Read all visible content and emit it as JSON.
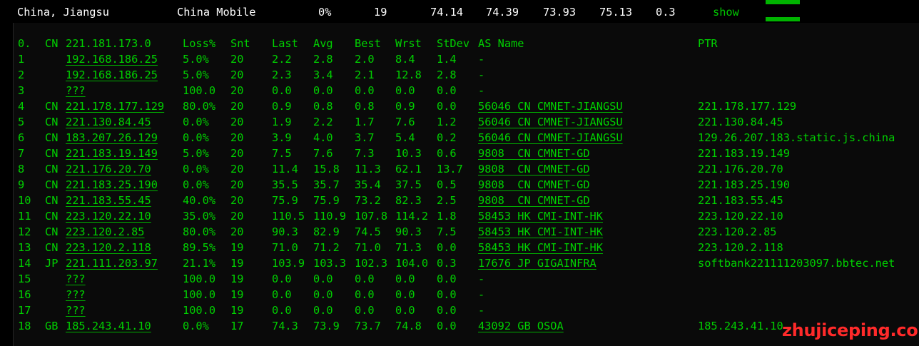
{
  "summary_row": {
    "location": "China, Jiangsu",
    "isp": "China Mobile",
    "loss": "0%",
    "sent": "19",
    "last": "74.14",
    "avg": "74.39",
    "best": "73.93",
    "worst": "75.13",
    "stdev": "0.3",
    "show_label": "show",
    "accent_color": "#00b400"
  },
  "header": {
    "hop": "0.",
    "cc": "CN",
    "ip": "221.181.173.0",
    "loss": "Loss%",
    "snt": "Snt",
    "last": "Last",
    "avg": "Avg",
    "best": "Best",
    "wrst": "Wrst",
    "stdev": "StDev",
    "asname": "AS Name",
    "ptr": "PTR"
  },
  "hops": [
    {
      "hop": "1",
      "cc": "",
      "ip": "192.168.186.25",
      "loss": "5.0%",
      "snt": "20",
      "last": "2.2",
      "avg": "2.8",
      "best": "2.0",
      "wrst": "8.4",
      "stdev": "1.4",
      "asname": "-",
      "ptr": ""
    },
    {
      "hop": "2",
      "cc": "",
      "ip": "192.168.186.25",
      "loss": "5.0%",
      "snt": "20",
      "last": "2.3",
      "avg": "3.4",
      "best": "2.1",
      "wrst": "12.8",
      "stdev": "2.8",
      "asname": "-",
      "ptr": ""
    },
    {
      "hop": "3",
      "cc": "",
      "ip": "???",
      "loss": "100.0",
      "snt": "20",
      "last": "0.0",
      "avg": "0.0",
      "best": "0.0",
      "wrst": "0.0",
      "stdev": "0.0",
      "asname": "-",
      "ptr": ""
    },
    {
      "hop": "4",
      "cc": "CN",
      "ip": "221.178.177.129",
      "loss": "80.0%",
      "snt": "20",
      "last": "0.9",
      "avg": "0.8",
      "best": "0.8",
      "wrst": "0.9",
      "stdev": "0.0",
      "asname": "56046 CN CMNET-JIANGSU",
      "ptr": "221.178.177.129"
    },
    {
      "hop": "5",
      "cc": "CN",
      "ip": "221.130.84.45",
      "loss": "0.0%",
      "snt": "20",
      "last": "1.9",
      "avg": "2.2",
      "best": "1.7",
      "wrst": "7.6",
      "stdev": "1.2",
      "asname": "56046 CN CMNET-JIANGSU",
      "ptr": "221.130.84.45"
    },
    {
      "hop": "6",
      "cc": "CN",
      "ip": "183.207.26.129",
      "loss": "0.0%",
      "snt": "20",
      "last": "3.9",
      "avg": "4.0",
      "best": "3.7",
      "wrst": "5.4",
      "stdev": "0.2",
      "asname": "56046 CN CMNET-JIANGSU",
      "ptr": "129.26.207.183.static.js.china"
    },
    {
      "hop": "7",
      "cc": "CN",
      "ip": "221.183.19.149",
      "loss": "5.0%",
      "snt": "20",
      "last": "7.5",
      "avg": "7.6",
      "best": "7.3",
      "wrst": "10.3",
      "stdev": "0.6",
      "asname": "9808  CN CMNET-GD",
      "ptr": "221.183.19.149"
    },
    {
      "hop": "8",
      "cc": "CN",
      "ip": "221.176.20.70",
      "loss": "0.0%",
      "snt": "20",
      "last": "11.4",
      "avg": "15.8",
      "best": "11.3",
      "wrst": "62.1",
      "stdev": "13.7",
      "asname": "9808  CN CMNET-GD",
      "ptr": "221.176.20.70"
    },
    {
      "hop": "9",
      "cc": "CN",
      "ip": "221.183.25.190",
      "loss": "0.0%",
      "snt": "20",
      "last": "35.5",
      "avg": "35.7",
      "best": "35.4",
      "wrst": "37.5",
      "stdev": "0.5",
      "asname": "9808  CN CMNET-GD",
      "ptr": "221.183.25.190"
    },
    {
      "hop": "10",
      "cc": "CN",
      "ip": "221.183.55.45",
      "loss": "40.0%",
      "snt": "20",
      "last": "75.9",
      "avg": "75.9",
      "best": "73.2",
      "wrst": "82.3",
      "stdev": "2.5",
      "asname": "9808  CN CMNET-GD",
      "ptr": "221.183.55.45"
    },
    {
      "hop": "11",
      "cc": "CN",
      "ip": "223.120.22.10",
      "loss": "35.0%",
      "snt": "20",
      "last": "110.5",
      "avg": "110.9",
      "best": "107.8",
      "wrst": "114.2",
      "stdev": "1.8",
      "asname": "58453 HK CMI-INT-HK",
      "ptr": "223.120.22.10"
    },
    {
      "hop": "12",
      "cc": "CN",
      "ip": "223.120.2.85",
      "loss": "80.0%",
      "snt": "20",
      "last": "90.3",
      "avg": "82.9",
      "best": "74.5",
      "wrst": "90.3",
      "stdev": "7.5",
      "asname": "58453 HK CMI-INT-HK",
      "ptr": "223.120.2.85"
    },
    {
      "hop": "13",
      "cc": "CN",
      "ip": "223.120.2.118",
      "loss": "89.5%",
      "snt": "19",
      "last": "71.0",
      "avg": "71.2",
      "best": "71.0",
      "wrst": "71.3",
      "stdev": "0.0",
      "asname": "58453 HK CMI-INT-HK",
      "ptr": "223.120.2.118"
    },
    {
      "hop": "14",
      "cc": "JP",
      "ip": "221.111.203.97",
      "loss": "21.1%",
      "snt": "19",
      "last": "103.9",
      "avg": "103.3",
      "best": "102.3",
      "wrst": "104.0",
      "stdev": "0.3",
      "asname": "17676 JP GIGAINFRA",
      "ptr": "softbank221111203097.bbtec.net"
    },
    {
      "hop": "15",
      "cc": "",
      "ip": "???",
      "loss": "100.0",
      "snt": "19",
      "last": "0.0",
      "avg": "0.0",
      "best": "0.0",
      "wrst": "0.0",
      "stdev": "0.0",
      "asname": "-",
      "ptr": ""
    },
    {
      "hop": "16",
      "cc": "",
      "ip": "???",
      "loss": "100.0",
      "snt": "19",
      "last": "0.0",
      "avg": "0.0",
      "best": "0.0",
      "wrst": "0.0",
      "stdev": "0.0",
      "asname": "-",
      "ptr": ""
    },
    {
      "hop": "17",
      "cc": "",
      "ip": "???",
      "loss": "100.0",
      "snt": "19",
      "last": "0.0",
      "avg": "0.0",
      "best": "0.0",
      "wrst": "0.0",
      "stdev": "0.0",
      "asname": "-",
      "ptr": ""
    },
    {
      "hop": "18",
      "cc": "GB",
      "ip": "185.243.41.10",
      "loss": "0.0%",
      "snt": "17",
      "last": "74.3",
      "avg": "73.9",
      "best": "73.7",
      "wrst": "74.8",
      "stdev": "0.0",
      "asname": "43092 GB OSOA",
      "ptr": "185.243.41.10"
    }
  ],
  "watermark": "zhujiceping.com",
  "colors": {
    "text_green": "#00d000",
    "watermark_red": "#ff2a2a",
    "background": "#000000"
  }
}
